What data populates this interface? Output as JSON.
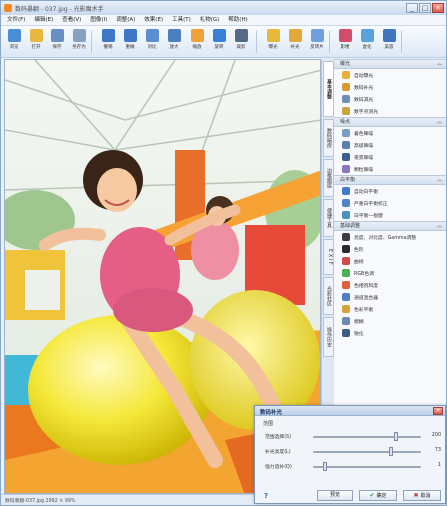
{
  "window": {
    "title": "数码暴翻 - 037.jpg - 光影魔术手",
    "controls": [
      "_",
      "□",
      "×"
    ]
  },
  "menu": [
    "文件(F)",
    "编辑(E)",
    "查看(V)",
    "图像(I)",
    "调整(A)",
    "效果(E)",
    "工具(T)",
    "礼物(G)",
    "帮助(H)"
  ],
  "toolbar": [
    {
      "label": "浏览",
      "icon": "browse-icon",
      "color": "#4a8fd6"
    },
    {
      "label": "打开",
      "icon": "open-folder-icon",
      "color": "#e9b840"
    },
    {
      "label": "保存",
      "icon": "save-icon",
      "color": "#6a8fc4"
    },
    {
      "label": "另存为",
      "icon": "save-as-icon",
      "color": "#8aa0c0"
    },
    {
      "label": "撤销",
      "icon": "undo-icon",
      "color": "#3d78c8"
    },
    {
      "label": "重做",
      "icon": "redo-icon",
      "color": "#3d78c8"
    },
    {
      "label": "对比",
      "icon": "compare-icon",
      "color": "#5a8ed0"
    },
    {
      "label": "放大",
      "icon": "zoom-in-icon",
      "color": "#4b7fc0"
    },
    {
      "label": "缩放",
      "icon": "resize-icon",
      "color": "#f0a23a"
    },
    {
      "label": "旋转",
      "icon": "rotate-icon",
      "color": "#3a80d8"
    },
    {
      "label": "裁剪",
      "icon": "crop-icon",
      "color": "#556a84"
    },
    {
      "label": "曝光",
      "icon": "exposure-icon",
      "color": "#e6b93c"
    },
    {
      "label": "补光",
      "icon": "fill-light-icon",
      "color": "#e2a83a"
    },
    {
      "label": "反转片",
      "icon": "reversal-film-icon",
      "color": "#6fa0dc"
    },
    {
      "label": "影楼",
      "icon": "studio-icon",
      "color": "#d24d6a"
    },
    {
      "label": "虚化",
      "icon": "blur-icon",
      "color": "#5aa2d8"
    },
    {
      "label": "美容",
      "icon": "beauty-icon",
      "color": "#3f74c0"
    }
  ],
  "side_tabs": [
    "基本调整",
    "数码暗房",
    "边框图层",
    "便捷工具",
    "E X I F",
    "光影社区",
    "操作历史"
  ],
  "panel": {
    "groups": [
      {
        "title": "曝光",
        "items": [
          {
            "label": "自动曝光",
            "icon": "auto-exposure-icon",
            "color": "#e7b13a"
          },
          {
            "label": "数码补光",
            "icon": "digital-fill-icon",
            "color": "#d79b2d"
          },
          {
            "label": "数码减光",
            "icon": "digital-reduce-icon",
            "color": "#6f8db5"
          },
          {
            "label": "数字点测光",
            "icon": "spot-metering-icon",
            "color": "#c9a43a"
          }
        ]
      },
      {
        "title": "噪点",
        "items": [
          {
            "label": "着色降噪",
            "icon": "denoise-icon",
            "color": "#7b9cc6"
          },
          {
            "label": "高级降噪",
            "icon": "advanced-denoise-icon",
            "color": "#5a7fb0"
          },
          {
            "label": "夜景降噪",
            "icon": "night-denoise-icon",
            "color": "#3b5f8f"
          },
          {
            "label": "颗粒降噪",
            "icon": "grain-denoise-icon",
            "color": "#8a76b8"
          }
        ]
      },
      {
        "title": "白平衡",
        "items": [
          {
            "label": "自动白平衡",
            "icon": "auto-white-balance-icon",
            "color": "#3f7bc8"
          },
          {
            "label": "严重白平衡校正",
            "icon": "white-balance-fix-icon",
            "color": "#5286c9"
          },
          {
            "label": "白平衡一指键",
            "icon": "white-balance-picker-icon",
            "color": "#4b90c0"
          }
        ]
      },
      {
        "title": "基础调整",
        "items": [
          {
            "label": "亮度、对比度、Gamma调整",
            "icon": "brightness-icon",
            "color": "#3c3c3c"
          },
          {
            "label": "色阶",
            "icon": "levels-icon",
            "color": "#2a2a2a"
          },
          {
            "label": "曲线",
            "icon": "curves-icon",
            "color": "#d04a4a"
          },
          {
            "label": "RGB色调",
            "icon": "rgb-icon",
            "color": "#4caf50"
          },
          {
            "label": "色相饱和度",
            "icon": "hue-saturation-icon",
            "color": "#e0603a"
          },
          {
            "label": "通道混合器",
            "icon": "channel-mixer-icon",
            "color": "#4f7fc6"
          },
          {
            "label": "色彩平衡",
            "icon": "color-balance-icon",
            "color": "#d6a03a"
          },
          {
            "label": "模糊",
            "icon": "blur-tool-icon",
            "color": "#6c8bb2"
          },
          {
            "label": "锐化",
            "icon": "sharpen-icon",
            "color": "#3d5c86"
          }
        ]
      }
    ]
  },
  "status": "数码暴翻-037.jpg  2992 × 99%",
  "dialog": {
    "title": "数码补光",
    "section": "范围",
    "sliders": [
      {
        "label": "范围选择(S)",
        "value": "200",
        "fraction": 0.78
      },
      {
        "label": "补光亮度(L)",
        "value": "73",
        "fraction": 0.73
      },
      {
        "label": "强力追补(Q)",
        "value": "1",
        "fraction": 0.1
      }
    ],
    "help": "?",
    "buttons": {
      "preview": "预览",
      "ok": "确定",
      "cancel": "取消"
    }
  }
}
